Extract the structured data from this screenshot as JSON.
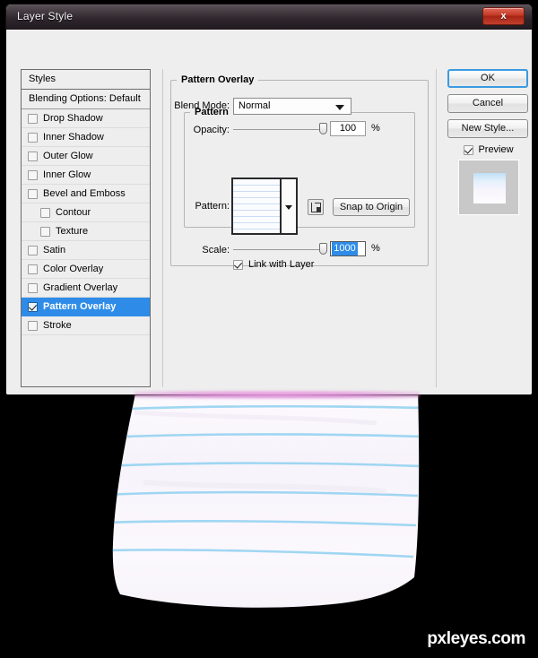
{
  "window": {
    "title": "Layer Style",
    "close_label": "x"
  },
  "sidebar": {
    "header": "Styles",
    "blending_options": "Blending Options: Default",
    "items": [
      {
        "label": "Drop Shadow",
        "checked": false,
        "indent": false,
        "selected": false
      },
      {
        "label": "Inner Shadow",
        "checked": false,
        "indent": false,
        "selected": false
      },
      {
        "label": "Outer Glow",
        "checked": false,
        "indent": false,
        "selected": false
      },
      {
        "label": "Inner Glow",
        "checked": false,
        "indent": false,
        "selected": false
      },
      {
        "label": "Bevel and Emboss",
        "checked": false,
        "indent": false,
        "selected": false
      },
      {
        "label": "Contour",
        "checked": false,
        "indent": true,
        "selected": false
      },
      {
        "label": "Texture",
        "checked": false,
        "indent": true,
        "selected": false
      },
      {
        "label": "Satin",
        "checked": false,
        "indent": false,
        "selected": false
      },
      {
        "label": "Color Overlay",
        "checked": false,
        "indent": false,
        "selected": false
      },
      {
        "label": "Gradient Overlay",
        "checked": false,
        "indent": false,
        "selected": false
      },
      {
        "label": "Pattern Overlay",
        "checked": true,
        "indent": false,
        "selected": true
      },
      {
        "label": "Stroke",
        "checked": false,
        "indent": false,
        "selected": false
      }
    ]
  },
  "main": {
    "section_title": "Pattern Overlay",
    "group_title": "Pattern",
    "blend_mode": {
      "label": "Blend Mode:",
      "value": "Normal"
    },
    "opacity": {
      "label": "Opacity:",
      "value": "100",
      "unit": "%",
      "percent": 100
    },
    "pattern": {
      "label": "Pattern:",
      "swatch_name": "lined-paper-pattern",
      "new_pattern_icon": "new-pattern-icon",
      "snap_button": "Snap to Origin"
    },
    "scale": {
      "label": "Scale:",
      "value": "1000",
      "unit": "%",
      "percent": 100,
      "selected": true
    },
    "link_with_layer": {
      "label": "Link with Layer",
      "checked": true
    }
  },
  "actions": {
    "ok": "OK",
    "cancel": "Cancel",
    "new_style": "New Style...",
    "preview": {
      "label": "Preview",
      "checked": true
    }
  },
  "colors": {
    "selection_blue": "#2e8ce8",
    "rule_blue": "#8fd0f0",
    "glow_pink": "#eea0e5",
    "close_red": "#c63b28"
  },
  "artwork": {
    "paper_alt": "curved-lined-paper-sheet",
    "rule_count": 6
  },
  "watermark": {
    "text": "pxleyes.com"
  }
}
